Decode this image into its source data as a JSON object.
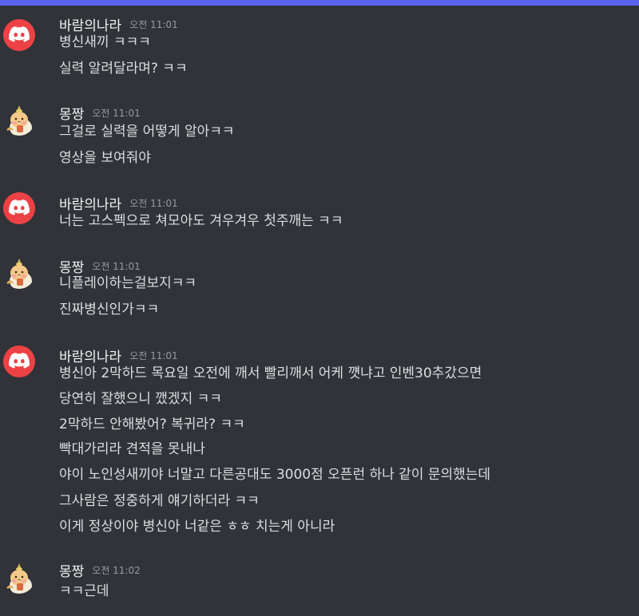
{
  "messages": [
    {
      "author": "바람의나라",
      "avatar_icon": "discord-logo-icon",
      "time": "오전 11:01",
      "lines": [
        "병신새끼 ㅋㅋㅋ",
        "실력 알려달라며? ㅋㅋ"
      ]
    },
    {
      "author": "몽짱",
      "avatar_icon": "hamster-avatar-icon",
      "time": "오전 11:01",
      "lines": [
        "그걸로 실력을 어떻게 알아ㅋㅋ",
        "영상을 보여줘야"
      ]
    },
    {
      "author": "바람의나라",
      "avatar_icon": "discord-logo-icon",
      "time": "오전 11:01",
      "lines": [
        "너는 고스펙으로 쳐모아도 겨우겨우 첫주깨는 ㅋㅋ"
      ]
    },
    {
      "author": "몽짱",
      "avatar_icon": "hamster-avatar-icon",
      "time": "오전 11:01",
      "lines": [
        "니플레이하는걸보지ㅋㅋ",
        "진짜병신인가ㅋㅋ"
      ]
    },
    {
      "author": "바람의나라",
      "avatar_icon": "discord-logo-icon",
      "time": "오전 11:01",
      "lines": [
        "병신아 2막하드 목요일 오전에 깨서 빨리깨서 어케 꺳냐고 인벤30추갔으면",
        "당연히 잘했으니 깼겠지 ㅋㅋ",
        "2막하드 안해봤어? 복귀라? ㅋㅋ",
        "빡대가리라 견적을 못내나",
        "야이 노인성새끼야 너말고 다른공대도 3000점 오픈런 하나 같이 문의했는데",
        "그사람은 정중하게 얘기하더라 ㅋㅋ",
        "이게 정상이야 병신아 너같은 ㅎㅎ 치는게 아니라"
      ]
    },
    {
      "author": "몽짱",
      "avatar_icon": "hamster-avatar-icon",
      "time": "오전 11:02",
      "lines": [
        "ㅋㅋ근데"
      ]
    }
  ],
  "colors": {
    "background": "#313338",
    "accent_bar": "#5865f2",
    "discord_red": "#ed4245",
    "username": "#f2f3f5",
    "timestamp": "#949ba4",
    "text": "#dbdee1"
  }
}
